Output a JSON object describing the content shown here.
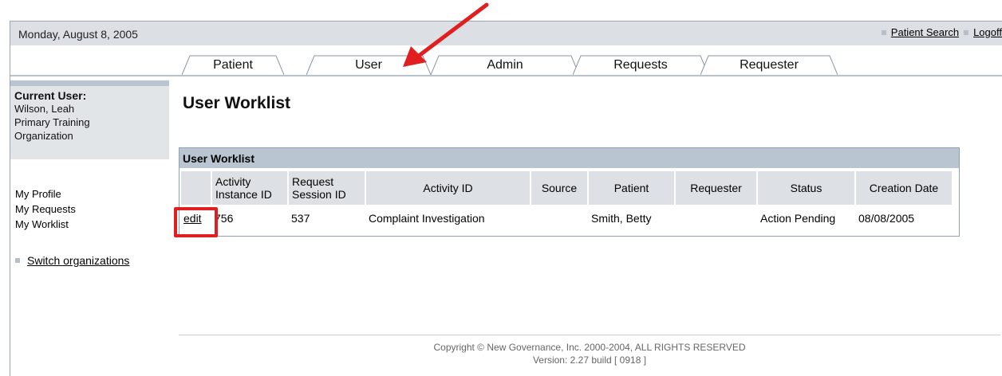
{
  "header": {
    "date": "Monday, August 8, 2005",
    "links": [
      "Patient Search",
      "Logoff"
    ]
  },
  "tabs": [
    "Patient",
    "User",
    "Admin",
    "Requests",
    "Requester"
  ],
  "sidebar": {
    "current_user_label": "Current User:",
    "current_user_lines": [
      "Wilson, Leah",
      "Primary Training",
      "Organization"
    ],
    "menu": [
      "My Profile",
      "My Requests",
      "My Worklist"
    ],
    "switch_label": "Switch organizations"
  },
  "main": {
    "title": "User Worklist",
    "table": {
      "caption": "User Worklist",
      "headers": [
        "",
        "Activity Instance ID",
        "Request Session ID",
        "Activity ID",
        "Source",
        "Patient",
        "Requester",
        "Status",
        "Creation Date"
      ],
      "header_lines": {
        "activity_instance": [
          "Activity",
          "Instance ID"
        ],
        "request_session": [
          "Request",
          "Session ID"
        ]
      },
      "rows": [
        {
          "action": "edit",
          "activity_instance_id": "756",
          "request_session_id": "537",
          "activity_id": "Complaint Investigation",
          "source": "",
          "patient": "Smith, Betty",
          "requester": "",
          "status": "Action Pending",
          "creation_date": "08/08/2005"
        }
      ]
    }
  },
  "footer": {
    "copyright": "Copyright © New Governance, Inc. 2000-2004, ALL RIGHTS RESERVED",
    "version": "Version: 2.27 build [ 0918 ]"
  },
  "colors": {
    "highlight_red": "#e02020",
    "topbar_bg": "#dcdfe3",
    "caption_bg": "#b9c6d2"
  }
}
